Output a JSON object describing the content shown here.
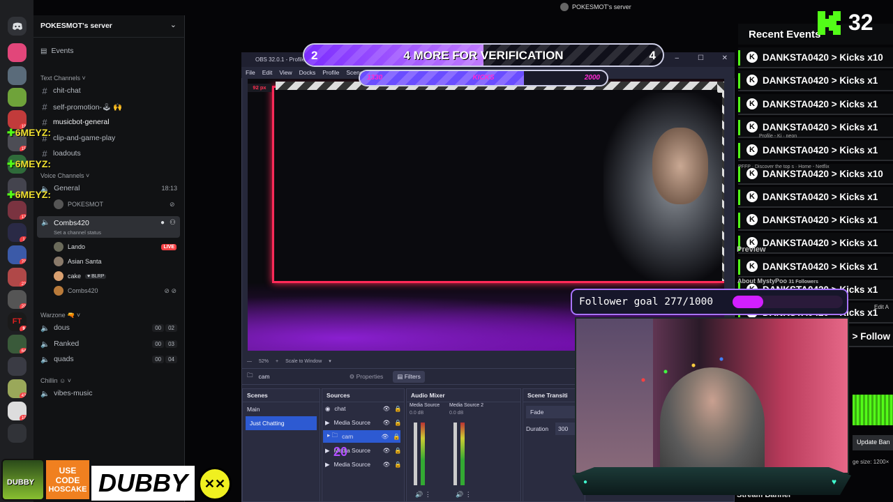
{
  "discord": {
    "server_name": "POKESMOT's server",
    "server_label_top": "POKESMOT's server",
    "events": "Events",
    "text_channels_header": "Text Channels",
    "text_channels": [
      "chit-chat",
      "self-promotion-🕹 🙌",
      "musicbot-general",
      "clip-and-game-play",
      "loadouts"
    ],
    "voice_channels_header": "Voice Channels",
    "voice_general": {
      "name": "General",
      "time": "18:13",
      "user": "POKESMOT"
    },
    "voice_combs": {
      "name": "Combs420",
      "status": "Set a channel status",
      "users": [
        {
          "name": "Lando",
          "badge": "LIVE"
        },
        {
          "name": "Asian Santa"
        },
        {
          "name": "cake",
          "tag": "BLRP"
        },
        {
          "name": "Combs420"
        }
      ]
    },
    "warzone_header": "Warzone",
    "warzone_channels": [
      {
        "name": "dous",
        "a": "00",
        "b": "02"
      },
      {
        "name": "Ranked",
        "a": "00",
        "b": "03"
      },
      {
        "name": "quads",
        "a": "00",
        "b": "04"
      }
    ],
    "chillin_header": "Chillin",
    "chillin_channels": [
      "vibes-music"
    ],
    "chat_overlays": [
      "6MEYZ:",
      "6MEYZ:",
      "6MEYZ:"
    ],
    "rail_badges": [
      "19",
      "15",
      "13",
      "1",
      "70",
      "23",
      "20",
      "9",
      "64",
      "43",
      "10"
    ]
  },
  "obs": {
    "title": "OBS 32.0.1 - Profile",
    "menu": [
      "File",
      "Edit",
      "View",
      "Docks",
      "Profile",
      "Scene"
    ],
    "px_label": "92 px",
    "zoom": "52%",
    "scale_mode": "Scale to Window",
    "selected_source": "cam",
    "properties": "Properties",
    "filters": "Filters",
    "scenes_header": "Scenes",
    "scenes": [
      "Main",
      "Just Chatting"
    ],
    "sources_header": "Sources",
    "sources": [
      "chat",
      "Media Source",
      "cam",
      "Media Source",
      "Media Source"
    ],
    "mixer_header": "Audio Mixer",
    "mixer": [
      {
        "name": "Media Source",
        "db": "0.0 dB"
      },
      {
        "name": "Media Source 2",
        "db": "0.0 dB"
      }
    ],
    "transitions_header": "Scene Transiti",
    "transition": "Fade",
    "duration_label": "Duration",
    "duration_value": "300"
  },
  "goal": {
    "left": "2",
    "text": "4 MORE FOR VERIFICATION",
    "right": "4",
    "sub_left": "1330",
    "sub_mid": "KICKS",
    "sub_right": "2000",
    "progress": 0.5
  },
  "kick": {
    "count": "32",
    "recent_events_title": "Recent Events",
    "events": [
      "DANKSTA0420 > Kicks x10",
      "DANKSTA0420 > Kicks x1",
      "DANKSTA0420 > Kicks x1",
      "DANKSTA0420 > Kicks x1",
      "DANKSTA0420 > Kicks x1",
      "DANKSTA0420 > Kicks x10",
      "DANKSTA0420 > Kicks x1",
      "DANKSTA0420 > Kicks x1",
      "DANKSTA0420 > Kicks x1",
      "DANKSTA0420 > Kicks x1",
      "DANKSTA0420 > Kicks x1",
      "DANKSTA0420 > Kicks x1"
    ],
    "follow_item": "> Follow",
    "bg_labels": {
      "preview": "Preview",
      "about": "About MystyPoo",
      "followers": "31 Followers",
      "edit": "Edit A",
      "update": "Update Ban",
      "image_size": "ge size: 1200×",
      "stream_banner": "Stream Banner",
      "profile": "Profile - Ki",
      "neon": "neon",
      "discover": "Discover the top s",
      "netflix": "Home - Netflix",
      "pfp": "PFFP"
    }
  },
  "follower_goal": {
    "label": "Follower goal 277/1000",
    "progress": 0.277
  },
  "sponsor": {
    "brand": "DUBBY",
    "use_code": "USE CODE",
    "code": "HOSCAKE"
  },
  "colors": {
    "kick_green": "#53fc18",
    "goal_purple": "#a84dff",
    "live_red": "#f23f43"
  }
}
